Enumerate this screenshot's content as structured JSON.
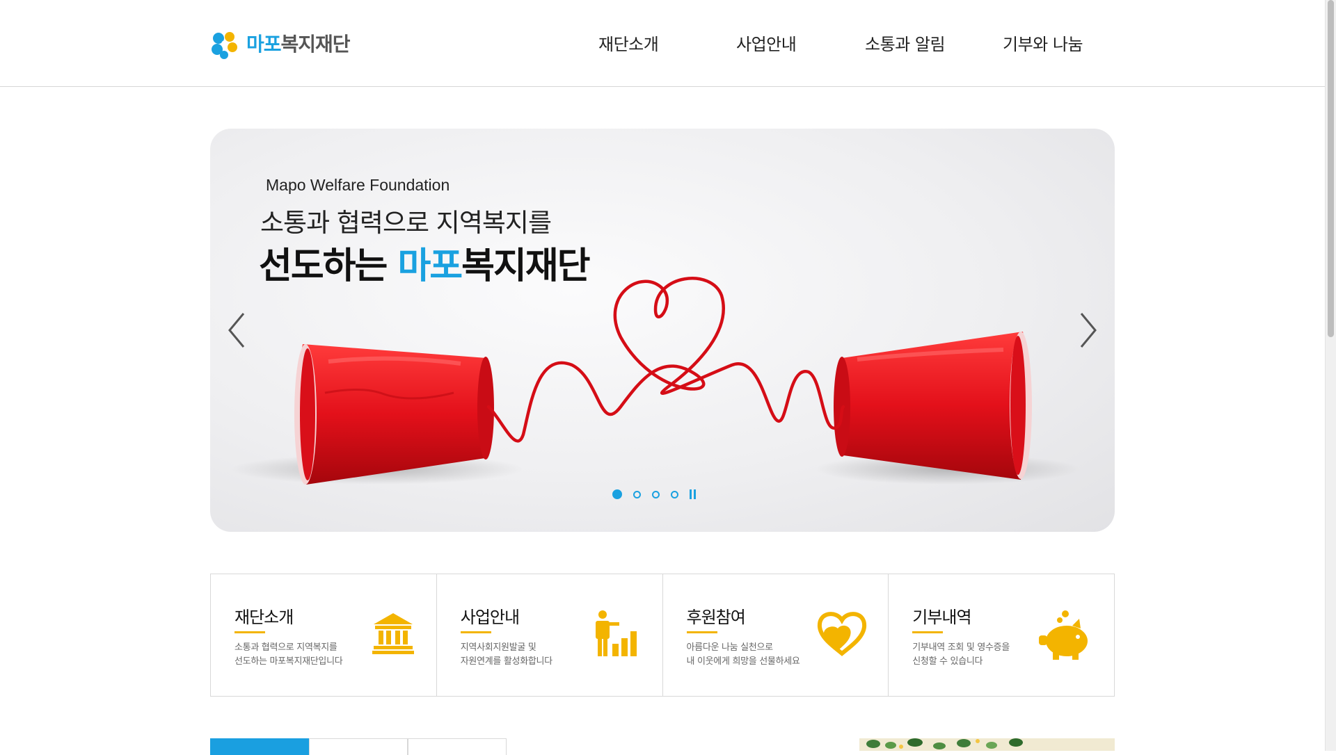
{
  "header": {
    "logo": {
      "text_1": "마포",
      "text_2": "복지재단"
    },
    "nav": [
      {
        "label": "재단소개"
      },
      {
        "label": "사업안내"
      },
      {
        "label": "소통과 알림"
      },
      {
        "label": "기부와 나눔"
      }
    ]
  },
  "hero": {
    "subtitle": "Mapo Welfare Foundation",
    "line1": "소통과 협력으로 지역복지를",
    "line2_prefix": "선도하는 ",
    "line2_highlight": "마포",
    "line2_suffix": "복지재단",
    "slides_total": 4,
    "active_slide": 1,
    "prev_icon": "chevron-left-icon",
    "next_icon": "chevron-right-icon",
    "pause_icon": "pause-icon"
  },
  "quick_links": [
    {
      "title": "재단소개",
      "desc": "소통과 협력으로 지역복지를\n선도하는 마포복지재단입니다",
      "icon": "building-icon"
    },
    {
      "title": "사업안내",
      "desc": "지역사회지원발굴 및\n자원연계를 활성화합니다",
      "icon": "growth-chart-icon"
    },
    {
      "title": "후원참여",
      "desc": "아름다운 나눔 실천으로\n내 이웃에게 희망을 선물하세요",
      "icon": "heart-hands-icon"
    },
    {
      "title": "기부내역",
      "desc": "기부내역 조회 및 영수증을\n신청할 수 있습니다",
      "icon": "piggy-bank-icon"
    }
  ],
  "colors": {
    "brand_blue": "#1aa1e0",
    "accent_yellow": "#f3b400",
    "cup_red": "#e3101a"
  }
}
